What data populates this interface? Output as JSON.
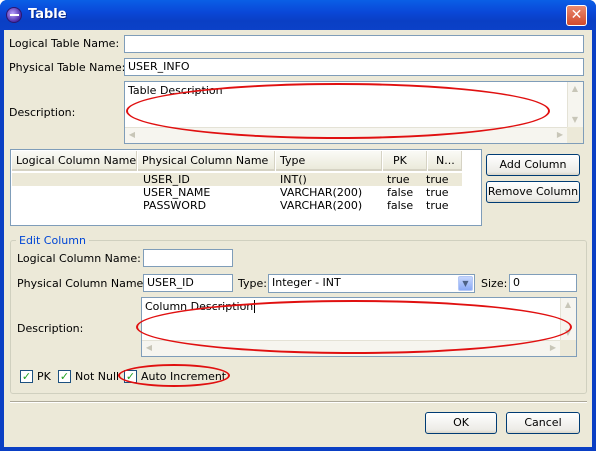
{
  "window": {
    "title": "Table"
  },
  "logical_table_name": {
    "label": "Logical Table Name:",
    "value": ""
  },
  "physical_table_name": {
    "label": "Physical Table Name:",
    "value": "USER_INFO"
  },
  "description": {
    "label": "Description:",
    "value": "Table Description"
  },
  "columns_table": {
    "headers": [
      "Logical Column Name",
      "Physical Column Name",
      "Type",
      "PK",
      "N..."
    ],
    "rows": [
      {
        "logical": "",
        "physical": "USER_ID",
        "type": "INT()",
        "pk": "true",
        "not_null": "true"
      },
      {
        "logical": "",
        "physical": "USER_NAME",
        "type": "VARCHAR(200)",
        "pk": "false",
        "not_null": "true"
      },
      {
        "logical": "",
        "physical": "PASSWORD",
        "type": "VARCHAR(200)",
        "pk": "false",
        "not_null": "true"
      }
    ]
  },
  "buttons": {
    "add_column": "Add Column",
    "remove_column": "Remove Column",
    "ok": "OK",
    "cancel": "Cancel"
  },
  "edit_column": {
    "title": "Edit Column",
    "logical_label": "Logical Column Name:",
    "logical_value": "",
    "physical_label": "Physical Column Name:",
    "physical_value": "USER_ID",
    "type_label": "Type:",
    "type_value": "Integer - INT",
    "size_label": "Size:",
    "size_value": "0",
    "description_label": "Description:",
    "description_value": "Column Description",
    "pk_label": "PK",
    "not_null_label": "Not Null",
    "auto_increment_label": "Auto Increment",
    "pk_checked": true,
    "not_null_checked": true,
    "auto_increment_checked": true
  },
  "icons": {
    "window": "eclipse-icon",
    "close": "close-icon",
    "dropdown": "chevron-down-icon",
    "check": "check-icon"
  },
  "colors": {
    "title_bar": "#0a48d8",
    "dialog_bg": "#ece9d8",
    "annotation": "#e01010",
    "group_title": "#0046d5"
  }
}
